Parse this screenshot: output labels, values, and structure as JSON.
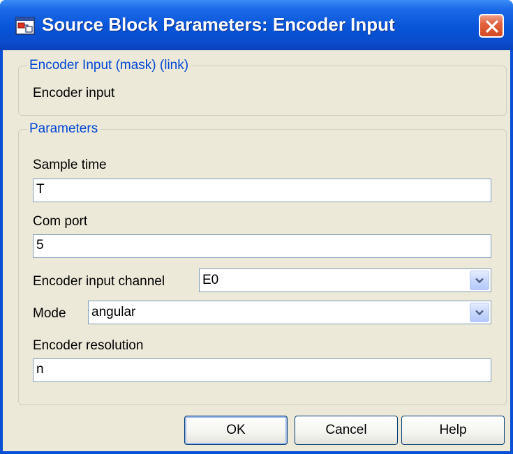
{
  "window": {
    "title": "Source Block Parameters: Encoder Input"
  },
  "description_group": {
    "legend": "Encoder Input (mask) (link)",
    "text": "Encoder input"
  },
  "parameters_group": {
    "legend": "Parameters",
    "sample_time": {
      "label": "Sample time",
      "value": "T"
    },
    "com_port": {
      "label": "Com port",
      "value": "5"
    },
    "encoder_channel": {
      "label": "Encoder input channel",
      "value": "E0"
    },
    "mode": {
      "label": "Mode",
      "value": "angular"
    },
    "encoder_resolution": {
      "label": "Encoder resolution",
      "value": "n"
    }
  },
  "buttons": {
    "ok": "OK",
    "cancel": "Cancel",
    "help": "Help"
  },
  "icons": {
    "app": "simulink-block-icon",
    "close": "close-icon",
    "dropdown": "chevron-down-icon"
  },
  "colors": {
    "titlebar": "#0754d8",
    "client": "#ece9d8",
    "legend_text": "#0046d5",
    "close_button": "#d24a22"
  }
}
